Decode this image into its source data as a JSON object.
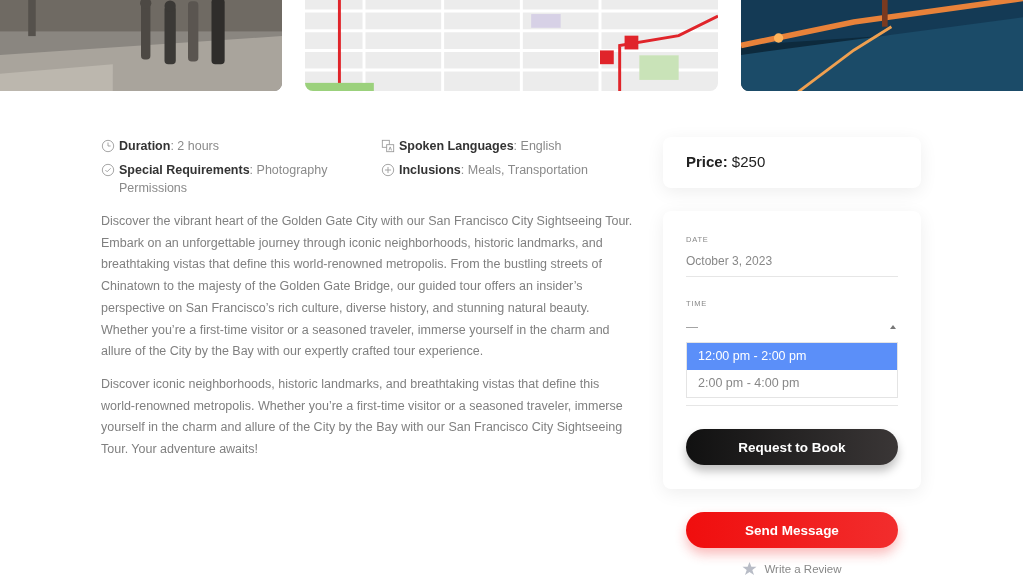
{
  "gallery": [
    {
      "kind": "picture"
    },
    {
      "kind": "picture"
    },
    {
      "kind": "picture"
    }
  ],
  "details": [
    "**Duration**: 2 hours",
    "**Spoken Languages**: English",
    "**Special Requirements**: Photography Permissions",
    "**Inclusions**: Meals, Transportation"
  ],
  "description": [
    "Discover the vibrant heart of the Golden Gate City with our San Francisco City Sightseeing Tour. Embark on an unforgettable journey through iconic neighborhoods, historic landmarks, and breathtaking vistas that define this world-renowned metropolis. From the bustling streets of Chinatown to the majesty of the Golden Gate Bridge, our guided tour offers an insider’s perspective on San Francisco’s rich culture, diverse history, and stunning natural beauty. Whether you’re a first-time visitor or a seasoned traveler, immerse yourself in the charm and allure of the City by the Bay with our expertly crafted tour experience.",
    "Discover iconic neighborhoods, historic landmarks, and breathtaking vistas that define this world-renowned metropolis. Whether you’re a first-time visitor or a seasoned traveler, immerse yourself in the charm and allure of the City by the Bay with our San Francisco City Sightseeing Tour. Your adventure awaits!"
  ],
  "price": {
    "label": "Price:",
    "value": "$250"
  },
  "booking": {
    "date": {
      "label": "DATE",
      "value": "October 3, 2023"
    },
    "time": {
      "label": "TIME",
      "placeholder": "—",
      "expanded": true,
      "options": [
        {
          "label": "12:00 pm - 2:00 pm",
          "selected": true
        },
        {
          "label": "2:00 pm - 4:00 pm",
          "selected": false
        }
      ]
    },
    "button": "Request to Book"
  },
  "send_button": "Send Message",
  "review_link": "Write a Review"
}
